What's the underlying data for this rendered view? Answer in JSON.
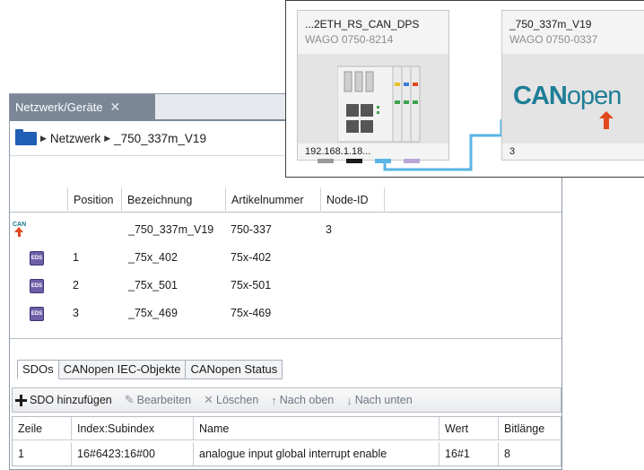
{
  "tab": {
    "title": "Netzwerk/Geräte"
  },
  "breadcrumb": {
    "root": "Netzwerk",
    "current": "_750_337m_V19"
  },
  "device_table": {
    "headers": [
      "Position",
      "Bezeichnung",
      "Artikelnummer",
      "Node-ID"
    ],
    "rows": [
      {
        "icon": "canopen-icon",
        "position": "",
        "name": "_750_337m_V19",
        "article": "750-337",
        "node_id": "3"
      },
      {
        "icon": "eds-icon",
        "position": "1",
        "name": "_75x_402",
        "article": "75x-402",
        "node_id": ""
      },
      {
        "icon": "eds-icon",
        "position": "2",
        "name": "_75x_501",
        "article": "75x-501",
        "node_id": ""
      },
      {
        "icon": "eds-icon",
        "position": "3",
        "name": "_75x_469",
        "article": "75x-469",
        "node_id": ""
      }
    ]
  },
  "tabs": [
    "SDOs",
    "CANopen IEC-Objekte",
    "CANopen Status"
  ],
  "toolbar": {
    "add": "SDO hinzufügen",
    "edit": "Bearbeiten",
    "delete": "Löschen",
    "up": "Nach oben",
    "down": "Nach unten"
  },
  "sdo_table": {
    "headers": [
      "Zeile",
      "Index:Subindex",
      "Name",
      "Wert",
      "Bitlänge"
    ],
    "rows": [
      {
        "zeile": "1",
        "index": "16#6423:16#00",
        "name": "analogue input global interrupt enable",
        "wert": "16#1",
        "bitlaenge": "8"
      }
    ]
  },
  "network": {
    "node1": {
      "name": "...2ETH_RS_CAN_DPS",
      "model": "WAGO 0750-8214",
      "ip": "192.168.1.18..."
    },
    "node2": {
      "name": "_750_337m_V19",
      "model": "WAGO 0750-0337",
      "logo_bold": "CAN",
      "logo_light": "open",
      "node_id": "3"
    },
    "colors": {
      "link": "#5ab4e6",
      "can_logo": "#1f7e97",
      "arrow": "#e04a1e"
    }
  }
}
